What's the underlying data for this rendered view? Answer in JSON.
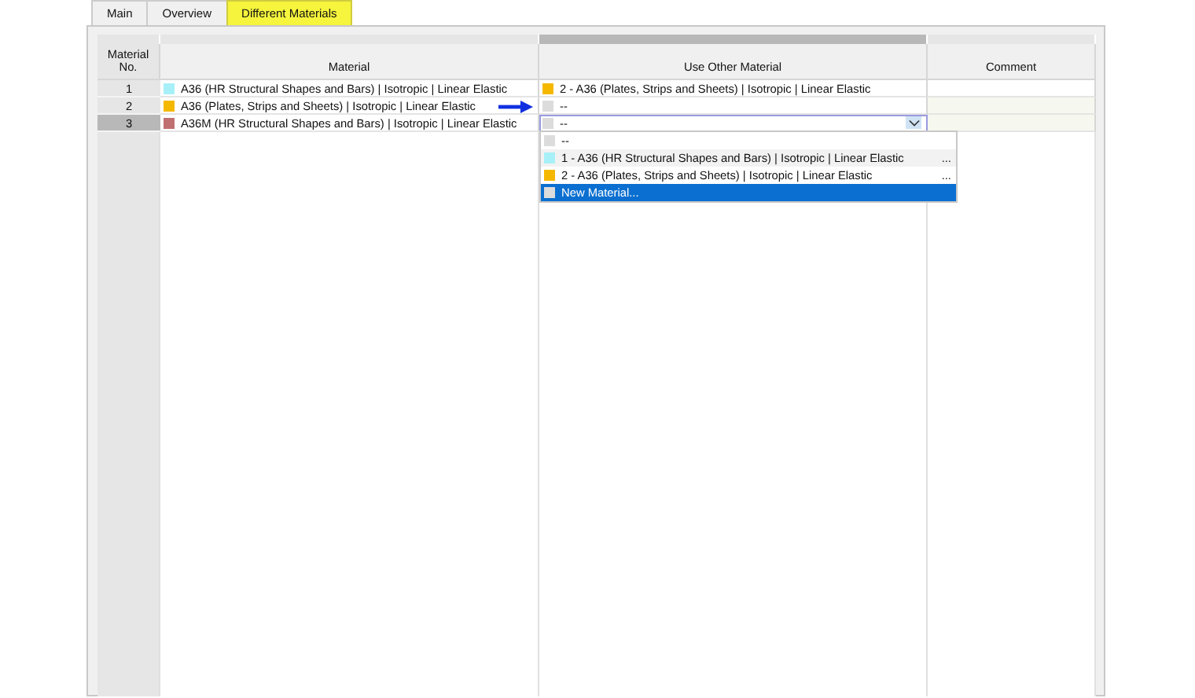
{
  "tabs": [
    {
      "label": "Main",
      "selected": false
    },
    {
      "label": "Overview",
      "selected": false
    },
    {
      "label": "Different Materials",
      "selected": true
    }
  ],
  "table": {
    "columns": [
      "Material\nNo.",
      "Material",
      "Use Other Material",
      "Comment"
    ],
    "rows": [
      {
        "no": "1",
        "selected": false,
        "material": {
          "color": "#a8f0f8",
          "text": "A36 (HR Structural Shapes and Bars) | Isotropic | Linear Elastic"
        },
        "other": {
          "color": "#f5b800",
          "text": "2 - A36 (Plates, Strips and Sheets) | Isotropic | Linear Elastic"
        },
        "arrow": false,
        "editing": false
      },
      {
        "no": "2",
        "selected": false,
        "material": {
          "color": "#f5b800",
          "text": "A36 (Plates, Strips and Sheets) | Isotropic | Linear Elastic"
        },
        "other": {
          "color": "#dcdcdc",
          "text": "--"
        },
        "arrow": true,
        "editing": false
      },
      {
        "no": "3",
        "selected": true,
        "material": {
          "color": "#c07070",
          "text": "A36M (HR Structural Shapes and Bars) | Isotropic | Linear Elastic"
        },
        "other": {
          "color": "#dcdcdc",
          "text": "--"
        },
        "arrow": false,
        "editing": true
      }
    ]
  },
  "dropdown": {
    "options": [
      {
        "color": "#dcdcdc",
        "text": "--",
        "selected": false
      },
      {
        "color": "#a8f0f8",
        "text": "1 - A36 (HR Structural Shapes and Bars) | Isotropic | Linear Elastic",
        "more": "...",
        "selected": false
      },
      {
        "color": "#f5b800",
        "text": "2 - A36 (Plates, Strips and Sheets) | Isotropic | Linear Elastic",
        "more": "...",
        "selected": false
      },
      {
        "color": "#dcdcdc",
        "text": "New Material...",
        "selected": true
      }
    ]
  }
}
